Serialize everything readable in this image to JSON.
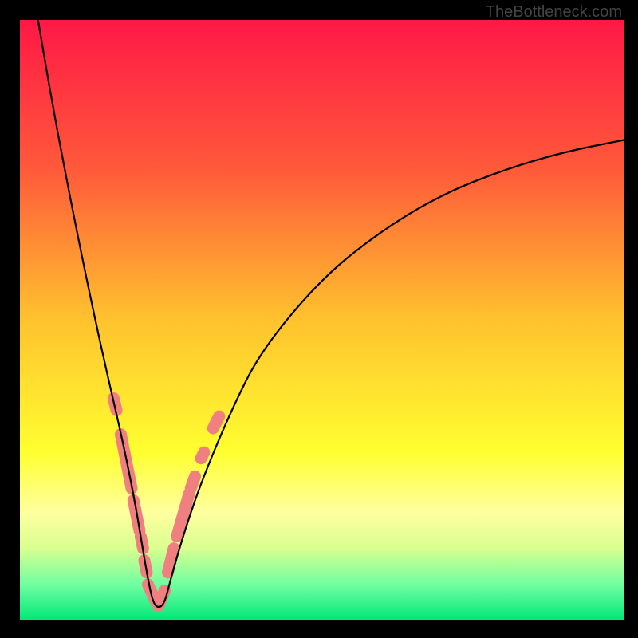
{
  "watermark": "TheBottleneck.com",
  "chart_data": {
    "type": "line",
    "title": "",
    "xlabel": "",
    "ylabel": "",
    "xlim": [
      0,
      100
    ],
    "ylim": [
      0,
      100
    ],
    "background_gradient": {
      "type": "vertical",
      "stops": [
        {
          "pos": 0,
          "color": "#ff1846"
        },
        {
          "pos": 25,
          "color": "#ff5a3a"
        },
        {
          "pos": 50,
          "color": "#ffc22e"
        },
        {
          "pos": 72,
          "color": "#ffff30"
        },
        {
          "pos": 82,
          "color": "#ffffa0"
        },
        {
          "pos": 88,
          "color": "#d8ff90"
        },
        {
          "pos": 94,
          "color": "#70ffa0"
        },
        {
          "pos": 100,
          "color": "#00e878"
        }
      ]
    },
    "series": [
      {
        "name": "curve",
        "color": "#000000",
        "data_comment": "V-shaped curve with minimum near x=22, left branch steep from top-left, right branch rises shallower toward upper-right",
        "x": [
          3,
          5,
          8,
          11,
          14,
          17,
          19,
          20,
          21,
          22,
          23,
          24,
          25,
          27,
          30,
          35,
          40,
          50,
          60,
          70,
          80,
          90,
          100
        ],
        "y": [
          100,
          88,
          72,
          57,
          43,
          30,
          20,
          14,
          8,
          3,
          2,
          3,
          7,
          14,
          23,
          35,
          45,
          57,
          65,
          71,
          75,
          78,
          80
        ]
      }
    ],
    "markers": {
      "color": "#f08080",
      "comment": "Salmon-colored rounded segments along lower V portion",
      "segments": [
        {
          "x_start": 15.5,
          "y_start": 37,
          "x_end": 16,
          "y_end": 35
        },
        {
          "x_start": 16.7,
          "y_start": 31,
          "x_end": 18.5,
          "y_end": 22
        },
        {
          "x_start": 18.8,
          "y_start": 20,
          "x_end": 19.8,
          "y_end": 15
        },
        {
          "x_start": 20,
          "y_start": 14,
          "x_end": 20.4,
          "y_end": 12
        },
        {
          "x_start": 20.6,
          "y_start": 10,
          "x_end": 21,
          "y_end": 8
        },
        {
          "x_start": 21.2,
          "y_start": 6,
          "x_end": 22.8,
          "y_end": 2.5
        },
        {
          "x_start": 23,
          "y_start": 2.5,
          "x_end": 24,
          "y_end": 5
        },
        {
          "x_start": 24.5,
          "y_start": 8,
          "x_end": 25.5,
          "y_end": 12
        },
        {
          "x_start": 26,
          "y_start": 14,
          "x_end": 28,
          "y_end": 21
        },
        {
          "x_start": 28.3,
          "y_start": 22,
          "x_end": 29,
          "y_end": 24
        },
        {
          "x_start": 30,
          "y_start": 27,
          "x_end": 30.5,
          "y_end": 28
        },
        {
          "x_start": 32,
          "y_start": 32,
          "x_end": 33,
          "y_end": 34
        }
      ]
    }
  }
}
